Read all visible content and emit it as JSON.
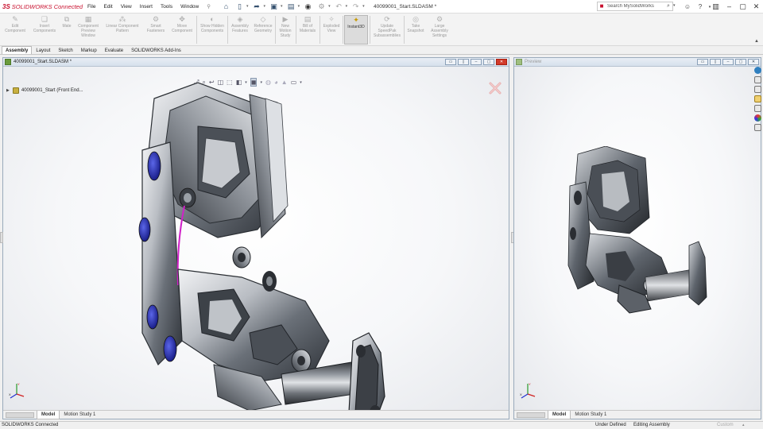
{
  "app": {
    "brand_ds": "3S",
    "brand_name": "SOLIDWORKS Connected",
    "document_title": "40099001_Start.SLDASM *"
  },
  "menu": [
    "File",
    "Edit",
    "View",
    "Insert",
    "Tools",
    "Window"
  ],
  "search": {
    "placeholder": "Search MySolidWorks"
  },
  "ribbon": {
    "buttons": [
      {
        "label": "Edit Component",
        "icon": "edit-component-icon",
        "enabled": false
      },
      {
        "label": "Insert Components",
        "icon": "insert-components-icon",
        "enabled": false
      },
      {
        "label": "Mate",
        "icon": "mate-icon",
        "enabled": false
      },
      {
        "label": "Component Preview Window",
        "icon": "preview-window-icon",
        "enabled": false
      },
      {
        "label": "Linear Component Pattern",
        "icon": "linear-pattern-icon",
        "enabled": false
      },
      {
        "label": "Smart Fasteners",
        "icon": "smart-fasteners-icon",
        "enabled": false
      },
      {
        "label": "Move Component",
        "icon": "move-component-icon",
        "enabled": false
      },
      {
        "label": "Show Hidden Components",
        "icon": "show-hidden-icon",
        "enabled": false
      },
      {
        "label": "Assembly Features",
        "icon": "assembly-features-icon",
        "enabled": false
      },
      {
        "label": "Reference Geometry",
        "icon": "reference-geometry-icon",
        "enabled": false
      },
      {
        "label": "New Motion Study",
        "icon": "motion-study-icon",
        "enabled": false
      },
      {
        "label": "Bill of Materials",
        "icon": "bom-icon",
        "enabled": false
      },
      {
        "label": "Exploded View",
        "icon": "exploded-view-icon",
        "enabled": false
      },
      {
        "label": "Instant3D",
        "icon": "instant3d-icon",
        "enabled": true
      },
      {
        "label": "Update SpeedPak Subassemblies",
        "icon": "speedpak-icon",
        "enabled": false
      },
      {
        "label": "Take Snapshot",
        "icon": "snapshot-icon",
        "enabled": false
      },
      {
        "label": "Large Assembly Settings",
        "icon": "large-assembly-icon",
        "enabled": false
      }
    ]
  },
  "command_tabs": [
    "Assembly",
    "Layout",
    "Sketch",
    "Markup",
    "Evaluate",
    "SOLIDWORKS Add-Ins"
  ],
  "main_view": {
    "title": "40099001_Start.SLDASM *",
    "tree_item": "40099001_Start (Front End...",
    "bottom_tabs": [
      "Model",
      "Motion Study 1"
    ]
  },
  "preview_view": {
    "title": "Preview",
    "bottom_tabs": [
      "Model",
      "Motion Study 1"
    ]
  },
  "status": {
    "left": "SOLIDWORKS Connected",
    "defined": "Under Defined",
    "mode": "Editing Assembly",
    "units": "Custom"
  },
  "colors": {
    "brand": "#c8102e",
    "accent_blue": "#1f2aa8",
    "highlight_magenta": "#d020c8",
    "metal_dark": "#3e434a",
    "metal_light": "#c9ccd1"
  }
}
